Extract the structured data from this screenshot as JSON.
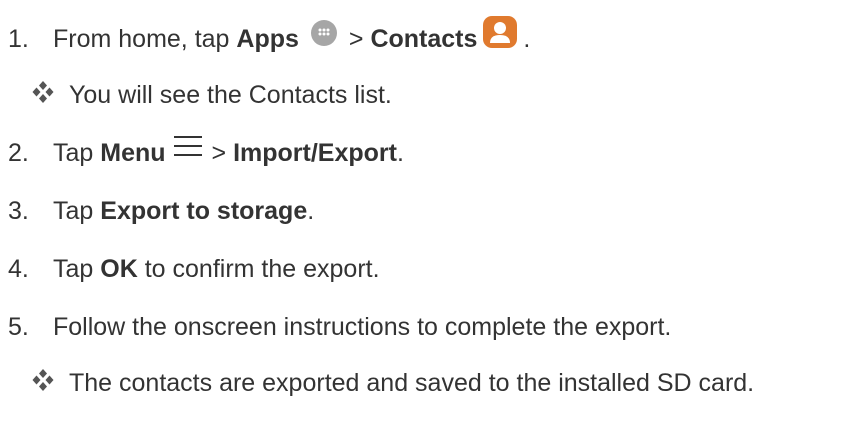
{
  "steps": [
    {
      "number": "1.",
      "part1": "From home, tap ",
      "bold1": "Apps",
      "icon1": "apps-icon",
      "sep": "> ",
      "bold2": "Contacts",
      "icon2": "contacts-icon",
      "end": "."
    },
    {
      "number": "2.",
      "part1": "Tap ",
      "bold1": "Menu",
      "icon1": "menu-icon",
      "sep": "> ",
      "bold2": "Import/Export",
      "end": "."
    },
    {
      "number": "3.",
      "part1": "Tap ",
      "bold1": "Export to storage",
      "end": "."
    },
    {
      "number": "4.",
      "part1": "Tap ",
      "bold1": "OK",
      "rest": " to confirm the export."
    },
    {
      "number": "5.",
      "text": "Follow the onscreen instructions to complete the export."
    }
  ],
  "results": [
    {
      "icon": "diamond-bullet-icon",
      "text": "You will see the Contacts list."
    },
    {
      "icon": "diamond-bullet-icon",
      "text": "The contacts are exported and saved to the installed SD card."
    }
  ],
  "colors": {
    "text": "#333333",
    "apps_icon": "#a6a6a6",
    "contacts_icon": "#e07a2e",
    "bullet": "#555555"
  }
}
